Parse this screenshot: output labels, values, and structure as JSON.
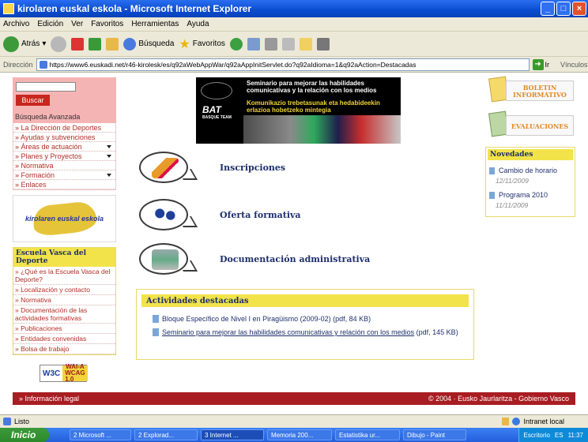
{
  "window": {
    "title": "kirolaren euskal eskola - Microsoft Internet Explorer"
  },
  "menu": [
    "Archivo",
    "Edición",
    "Ver",
    "Favoritos",
    "Herramientas",
    "Ayuda"
  ],
  "toolbar": {
    "back": "Atrás",
    "search": "Búsqueda",
    "favorites": "Favoritos"
  },
  "address": {
    "label": "Dirección",
    "url": "https://www6.euskadi.net/r46-kirolesk/es/q92aWebAppWar/q92aAppInitServlet.do?q92aIdioma=1&q92aAction=Destacadas",
    "go": "Ir",
    "links": "Vínculos"
  },
  "search": {
    "button": "Buscar",
    "advanced": "Búsqueda Avanzada"
  },
  "nav": [
    {
      "label": "La Dirección de Deportes",
      "dd": false
    },
    {
      "label": "Ayudas y subvenciones",
      "dd": false
    },
    {
      "label": "Áreas de actuación",
      "dd": true
    },
    {
      "label": "Planes y Proyectos",
      "dd": true
    },
    {
      "label": "Normativa",
      "dd": false
    },
    {
      "label": "Formación",
      "dd": true
    },
    {
      "label": "Enlaces",
      "dd": false
    }
  ],
  "logo_text": "kirolaren euskal eskola",
  "evbox": {
    "title": "Escuela Vasca del Deporte",
    "items": [
      "¿Qué es la Escuela Vasca del Deporte?",
      "Localización y contacto",
      "Normativa",
      "Documentación de las actividades formativas",
      "Publicaciones",
      "Entidades convenidas",
      "Bolsa de trabajo"
    ]
  },
  "w3c": {
    "left": "W3C",
    "right1": "WAI-A",
    "right2": "WCAG 1.0"
  },
  "banner": {
    "line_es": "Seminario para mejorar las habilidades comunicativas y la relación con los medios",
    "line_eu": "Komunikazio trebetasunak eta hedabideekin erlazioa hobetzeko mintegia",
    "brand": "BAT",
    "brand_sub": "BASQUE TEAM"
  },
  "links": [
    "Inscripciones",
    "Oferta formativa",
    "Documentación administrativa"
  ],
  "actividades": {
    "title": "Actividades destacadas",
    "items": [
      {
        "text": "Bloque Específico de Nivel I en Piragüismo (2009-02) (pdf, 84 KB)"
      },
      {
        "link": "Seminario para mejorar las habilidades comunicativas y relación con los medios",
        "suffix": " (pdf, 145 KB)"
      }
    ]
  },
  "right": {
    "boletin": "BOLETIN INFORMATIVO",
    "evaluaciones": "EVALUACIONES",
    "novedades": {
      "title": "Novedades",
      "items": [
        {
          "label": "Cambio de horario",
          "date": "12/11/2009"
        },
        {
          "label": "Programa 2010",
          "date": "11/11/2009"
        }
      ]
    }
  },
  "footer": {
    "left": "» Información legal",
    "right": "© 2004 · Eusko Jaurlaritza - Gobierno Vasco"
  },
  "status": {
    "left": "Listo",
    "right": "Intranet local"
  },
  "taskbar": {
    "start": "Inicio",
    "tasks": [
      "2 Microsoft ...",
      "2 Explorad...",
      "3 Internet ...",
      "Memoria 200...",
      "Estatistika ur...",
      "Dibujo - Paint"
    ],
    "tray_label": "Escritorio",
    "lang": "ES",
    "time": "11:37"
  }
}
